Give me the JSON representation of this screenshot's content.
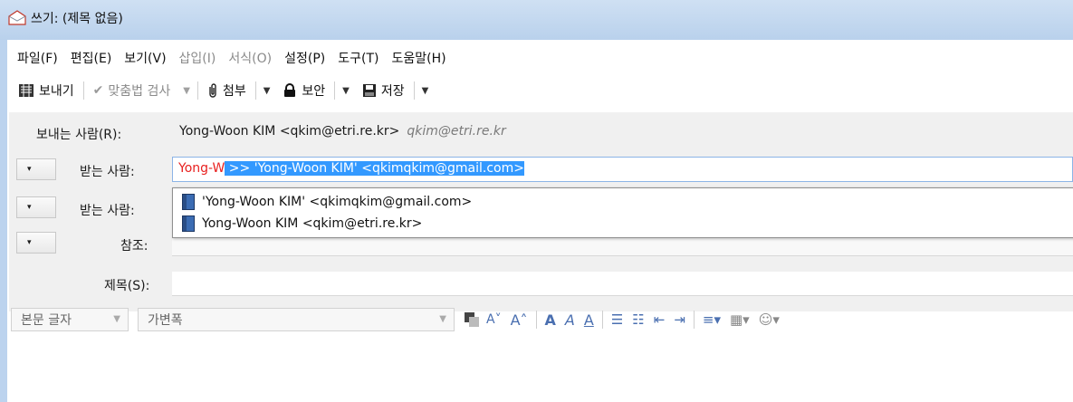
{
  "window": {
    "title": "쓰기: (제목 없음)"
  },
  "menu": {
    "items": [
      {
        "label": "파일(F)",
        "enabled": true
      },
      {
        "label": "편집(E)",
        "enabled": true
      },
      {
        "label": "보기(V)",
        "enabled": true
      },
      {
        "label": "삽입(I)",
        "enabled": false
      },
      {
        "label": "서식(O)",
        "enabled": false
      },
      {
        "label": "설정(P)",
        "enabled": true
      },
      {
        "label": "도구(T)",
        "enabled": true
      },
      {
        "label": "도움말(H)",
        "enabled": true
      }
    ]
  },
  "toolbar": {
    "send_label": "보내기",
    "spell_label": "맞춤법 검사",
    "attach_label": "첨부",
    "security_label": "보안",
    "save_label": "저장"
  },
  "header": {
    "from_label": "보내는 사람(R):",
    "from_value": "Yong-Woon KIM <qkim@etri.re.kr>",
    "from_alt": "qkim@etri.re.kr",
    "to_label": "받는 사람:",
    "to_typed": "Yong-W",
    "to_autocomplete": " >> 'Yong-Woon KIM' <qkimqkim@gmail.com>",
    "to2_label": "받는 사람:",
    "cc_label": "참조:",
    "subject_label": "제목(S):",
    "type_dropdown_glyph": "▾"
  },
  "autocomplete": {
    "items": [
      "'Yong-Woon KIM' <qkimqkim@gmail.com>",
      "Yong-Woon KIM <qkim@etri.re.kr>"
    ]
  },
  "format": {
    "paragraph_label": "본문 글자",
    "font_label": "가변폭"
  }
}
